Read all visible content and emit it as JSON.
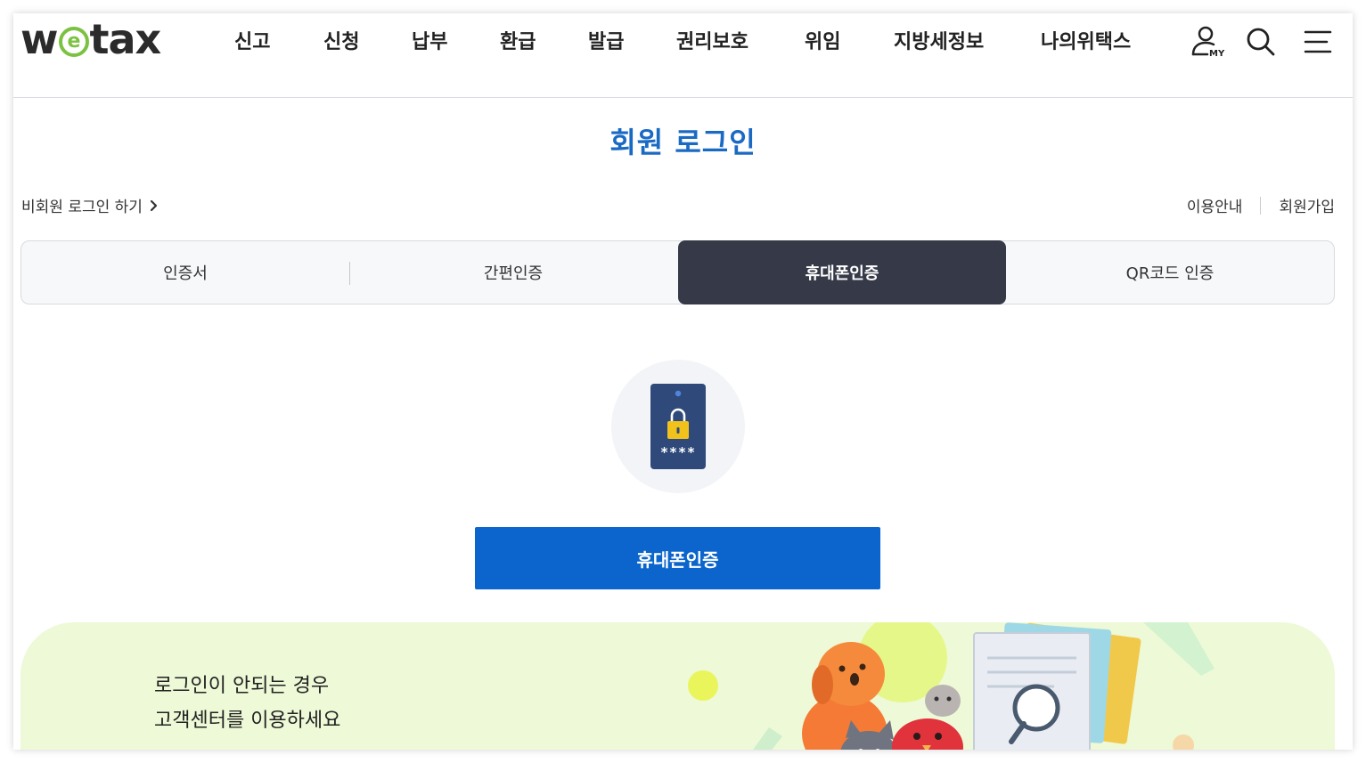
{
  "header": {
    "logo": {
      "left": "w",
      "mark": "e",
      "right": "tax"
    },
    "nav": [
      "신고",
      "신청",
      "납부",
      "환급",
      "발급",
      "권리보호",
      "위임",
      "지방세정보",
      "나의위택스"
    ],
    "icons": {
      "my": "user-my-icon",
      "search": "search-icon",
      "menu": "hamburger-menu-icon"
    },
    "my_label": "MY"
  },
  "page_title": "회원 로그인",
  "links": {
    "guest_login": "비회원 로그인 하기",
    "guide": "이용안내",
    "signup": "회원가입"
  },
  "tabs": [
    {
      "label": "인증서",
      "active": false
    },
    {
      "label": "간편인증",
      "active": false
    },
    {
      "label": "휴대폰인증",
      "active": true
    },
    {
      "label": "QR코드 인증",
      "active": false
    }
  ],
  "auth": {
    "icon": "phone-lock-icon",
    "pin_mask": "****",
    "button_label": "휴대폰인증"
  },
  "banner": {
    "line1": "로그인이 안되는 경우",
    "line2": "고객센터를 이용하세요"
  },
  "colors": {
    "title_blue": "#1a6ac4",
    "button_blue": "#0b65cc",
    "active_tab": "#363a48",
    "logo_green": "#7cc242",
    "banner_bg": "#eef9d7"
  }
}
